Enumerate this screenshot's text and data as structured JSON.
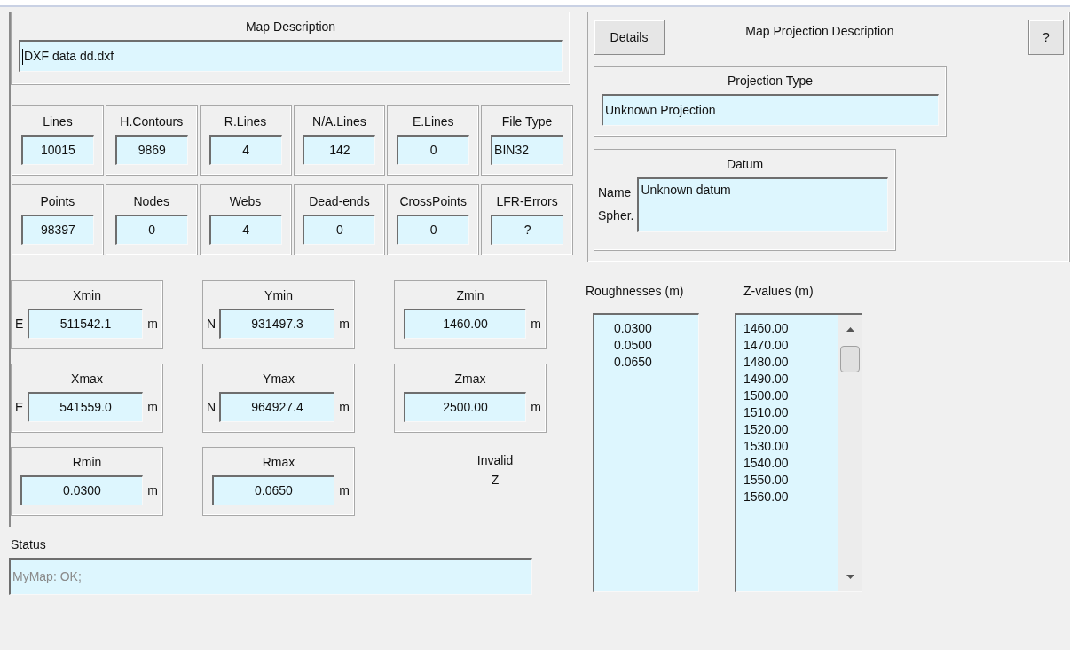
{
  "map_description": {
    "label": "Map Description",
    "value": "DXF data dd.dxf"
  },
  "counts": [
    {
      "label": "Lines",
      "value": "10015",
      "kind": "number"
    },
    {
      "label": "H.Contours",
      "value": "9869",
      "kind": "number"
    },
    {
      "label": "R.Lines",
      "value": "4",
      "kind": "number"
    },
    {
      "label": "N/A.Lines",
      "value": "142",
      "kind": "number"
    },
    {
      "label": "E.Lines",
      "value": "0",
      "kind": "number"
    },
    {
      "label": "File Type",
      "value": "BIN32",
      "kind": "text"
    },
    {
      "label": "Points",
      "value": "98397",
      "kind": "number"
    },
    {
      "label": "Nodes",
      "value": "0",
      "kind": "number"
    },
    {
      "label": "Webs",
      "value": "4",
      "kind": "number"
    },
    {
      "label": "Dead-ends",
      "value": "0",
      "kind": "number"
    },
    {
      "label": "CrossPoints",
      "value": "0",
      "kind": "number"
    },
    {
      "label": "LFR-Errors",
      "value": "?",
      "kind": "number"
    }
  ],
  "projection": {
    "details_button": "Details",
    "title": "Map Projection Description",
    "help_button": "?",
    "projection_type": {
      "label": "Projection Type",
      "value": "Unknown Projection"
    },
    "datum": {
      "label": "Datum",
      "name_label": "Name",
      "spheroid_label": "Spher.",
      "value": "Unknown datum"
    }
  },
  "extents": [
    {
      "label": "Xmin",
      "prefix": "E",
      "value": "511542.1",
      "unit": "m"
    },
    {
      "label": "Ymin",
      "prefix": "N",
      "value": "931497.3",
      "unit": "m"
    },
    {
      "label": "Zmin",
      "value": "1460.00",
      "unit": "m"
    },
    {
      "label": "Xmax",
      "prefix": "E",
      "value": "541559.0",
      "unit": "m"
    },
    {
      "label": "Ymax",
      "prefix": "N",
      "value": "964927.4",
      "unit": "m"
    },
    {
      "label": "Zmax",
      "value": "2500.00",
      "unit": "m"
    },
    {
      "label": "Rmin",
      "value": "0.0300",
      "unit": "m"
    },
    {
      "label": "Rmax",
      "value": "0.0650",
      "unit": "m"
    }
  ],
  "invalid_z": "Invalid Z",
  "status": {
    "label": "Status",
    "value": "MyMap: OK;",
    "disabled": true
  },
  "roughnesses": {
    "label": "Roughnesses (m)",
    "items": [
      "0.0300",
      "0.0500",
      "0.0650"
    ]
  },
  "z_values": {
    "label": "Z-values (m)",
    "items": [
      "1460.00",
      "1470.00",
      "1480.00",
      "1490.00",
      "1500.00",
      "1510.00",
      "1520.00",
      "1530.00",
      "1540.00",
      "1550.00",
      "1560.00"
    ]
  }
}
